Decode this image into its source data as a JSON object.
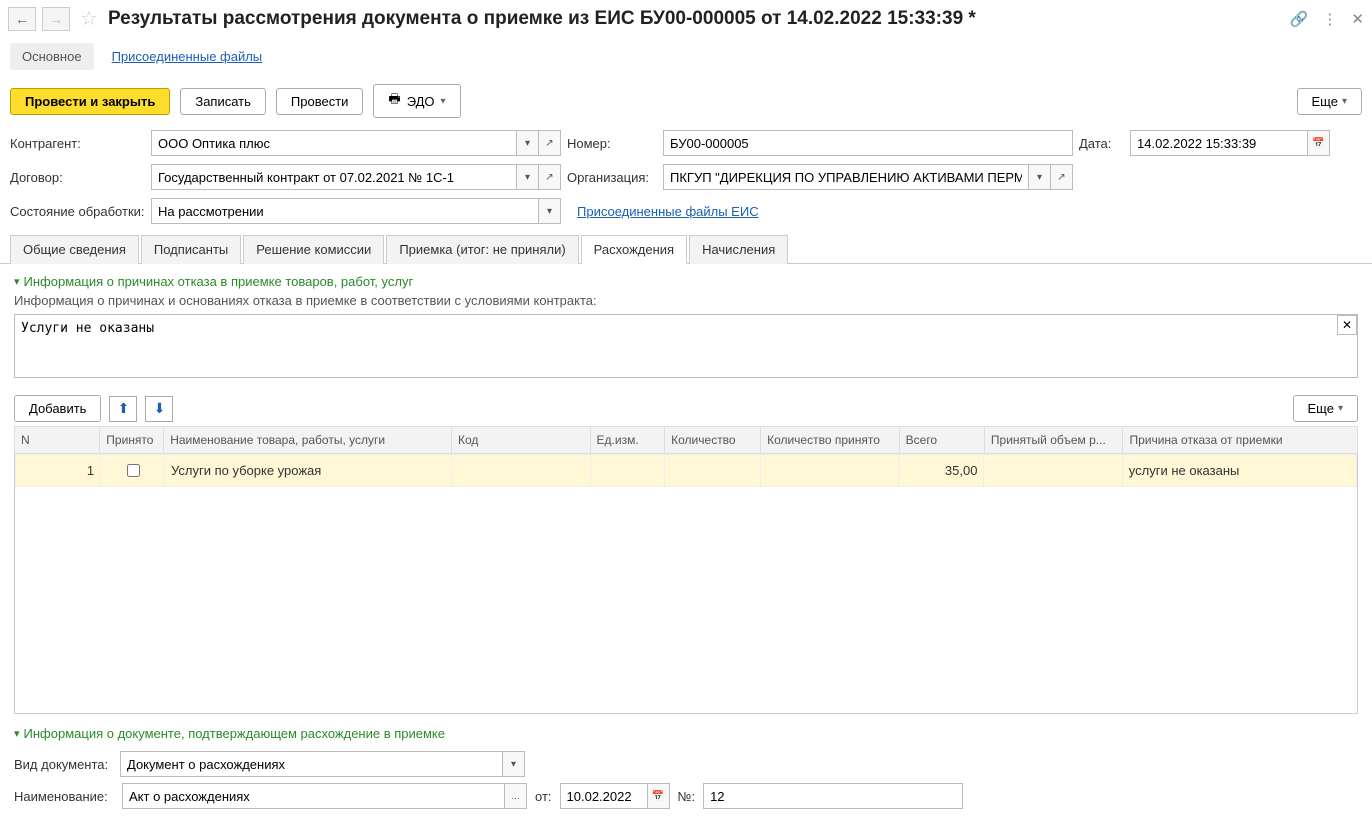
{
  "header": {
    "title": "Результаты рассмотрения документа о приемке из ЕИС БУ00-000005 от 14.02.2022 15:33:39 *"
  },
  "subnav": {
    "main": "Основное",
    "attached": "Присоединенные файлы"
  },
  "toolbar": {
    "post_close": "Провести и закрыть",
    "save": "Записать",
    "post": "Провести",
    "edo": "ЭДО",
    "more": "Еще"
  },
  "fields": {
    "contractor_label": "Контрагент:",
    "contractor": "ООО Оптика плюс",
    "number_label": "Номер:",
    "number": "БУ00-000005",
    "date_label": "Дата:",
    "date": "14.02.2022 15:33:39",
    "contract_label": "Договор:",
    "contract": "Государственный контракт от 07.02.2021 № 1С-1",
    "org_label": "Организация:",
    "org": "ПКГУП \"ДИРЕКЦИЯ ПО УПРАВЛЕНИЮ АКТИВАМИ ПЕРМС",
    "status_label": "Состояние обработки:",
    "status": "На рассмотрении",
    "eis_files": "Присоединенные файлы ЕИС"
  },
  "tabs": {
    "general": "Общие сведения",
    "signers": "Подписанты",
    "commission": "Решение комиссии",
    "acceptance": "Приемка (итог: не приняли)",
    "discrepancies": "Расхождения",
    "accruals": "Начисления"
  },
  "section1": {
    "title": "Информация о причинах отказа в приемке товаров, работ, услуг",
    "subtitle": "Информация о причинах и основаниях отказа в приемке в соответствии с условиями контракта:",
    "text": "Услуги не оказаны"
  },
  "table": {
    "add": "Добавить",
    "more": "Еще",
    "headers": {
      "n": "N",
      "accepted": "Принято",
      "name": "Наименование товара, работы, услуги",
      "code": "Код",
      "unit": "Ед.изм.",
      "qty": "Количество",
      "qty_accepted": "Количество принято",
      "total": "Всего",
      "volume": "Принятый объем р...",
      "reason": "Причина отказа от приемки"
    },
    "rows": [
      {
        "n": "1",
        "accepted": false,
        "name": "Услуги по уборке урожая",
        "code": "",
        "unit": "",
        "qty": "",
        "qty_accepted": "",
        "total": "35,00",
        "volume": "",
        "reason": "услуги не оказаны"
      }
    ]
  },
  "section2": {
    "title": "Информация о документе, подтверждающем расхождение в приемке",
    "doctype_label": "Вид документа:",
    "doctype": "Документ о расхождениях",
    "name_label": "Наименование:",
    "name": "Акт о расхождениях",
    "from_label": "от:",
    "from": "10.02.2022",
    "no_label": "№:",
    "no": "12"
  }
}
